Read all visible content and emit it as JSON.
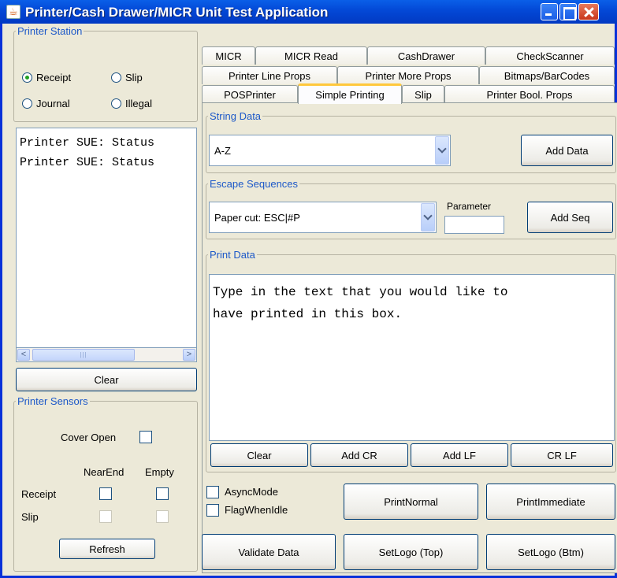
{
  "window": {
    "title": "Printer/Cash Drawer/MICR Unit Test Application",
    "app_icon": "java-cup-icon"
  },
  "printer_station": {
    "legend": "Printer Station",
    "options": [
      "Receipt",
      "Slip",
      "Journal",
      "Illegal"
    ],
    "selected": "Receipt"
  },
  "log": {
    "lines": [
      "Printer SUE: Status",
      "Printer SUE: Status"
    ],
    "clear_label": "Clear"
  },
  "sensors": {
    "legend": "Printer Sensors",
    "cover_open_label": "Cover Open",
    "col_nearend": "NearEnd",
    "col_empty": "Empty",
    "row_receipt": "Receipt",
    "row_slip": "Slip",
    "refresh_label": "Refresh"
  },
  "tabs": {
    "row1": [
      "MICR",
      "MICR Read",
      "CashDrawer",
      "CheckScanner"
    ],
    "row2": [
      "Printer Line Props",
      "Printer More Props",
      "Bitmaps/BarCodes"
    ],
    "row3": [
      "POSPrinter",
      "Simple Printing",
      "Slip",
      "Printer Bool. Props"
    ],
    "active": "Simple Printing"
  },
  "string_data": {
    "legend": "String Data",
    "selected": "A-Z",
    "add_label": "Add Data"
  },
  "escape_sequences": {
    "legend": "Escape Sequences",
    "selected": "Paper cut: ESC|#P",
    "parameter_label": "Parameter",
    "parameter_value": "",
    "add_label": "Add Seq"
  },
  "print_data": {
    "legend": "Print Data",
    "text": "Type in the text that you would like to\nhave printed in this box.",
    "buttons": [
      "Clear",
      "Add CR",
      "Add LF",
      "CR LF"
    ]
  },
  "options": {
    "async_mode": "AsyncMode",
    "flag_when_idle": "FlagWhenIdle"
  },
  "actions": {
    "print_normal": "PrintNormal",
    "print_immediate": "PrintImmediate",
    "validate_data": "Validate Data",
    "setlogo_top": "SetLogo (Top)",
    "setlogo_btm": "SetLogo (Btm)"
  }
}
